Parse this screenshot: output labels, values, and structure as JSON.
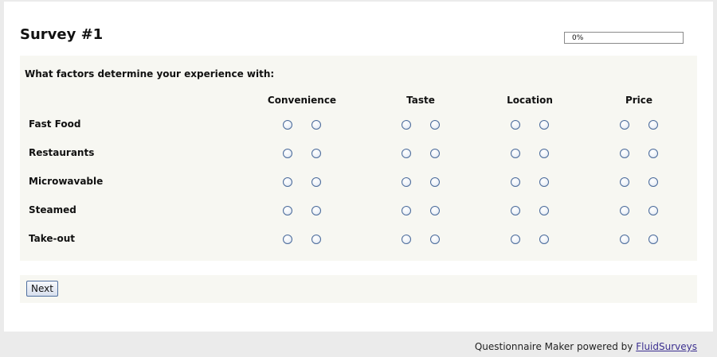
{
  "survey": {
    "title": "Survey #1",
    "progress_percent": 0,
    "progress_label": "0%"
  },
  "question": {
    "text": "What factors determine your experience with:",
    "columns": [
      "Convenience",
      "Taste",
      "Location",
      "Price"
    ],
    "options_per_column": 2,
    "rows": [
      "Fast Food",
      "Restaurants",
      "Microwavable",
      "Steamed",
      "Take-out"
    ]
  },
  "navigation": {
    "next_label": "Next"
  },
  "footer": {
    "text": "Questionnaire Maker powered by ",
    "link_text": "FluidSurveys"
  },
  "colors": {
    "page_bg": "#ebebeb",
    "panel_bg": "#f7f7f2",
    "radio_border": "#4a6a9a",
    "link": "#3b2f8f"
  }
}
